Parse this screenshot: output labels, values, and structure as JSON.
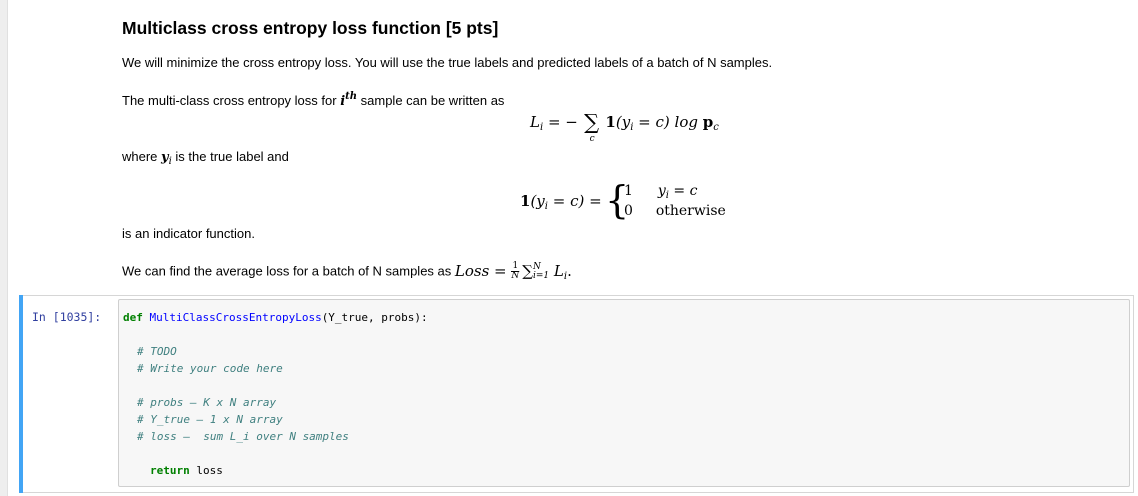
{
  "markdown": {
    "title": "Multiclass cross entropy loss function [5 pts]",
    "intro": "We will minimize the cross entropy loss. You will use the true labels and predicted labels of a batch of N samples.",
    "loss_intro_pre": "The multi-class cross entropy loss for ",
    "loss_intro_var": "i",
    "loss_intro_sup": "th",
    "loss_intro_post": " sample can be written as",
    "eq1": {
      "lhs": "L",
      "lhs_sub": "i",
      "equals": " = −",
      "sigma": "∑",
      "sigma_sub": "c",
      "indicator": "1",
      "arg_open": "(y",
      "arg_sub": "i",
      "arg_rest": " = c) log ",
      "p": "p",
      "p_sub": "c"
    },
    "where_pre": "where ",
    "where_var": "y",
    "where_sub": "i",
    "where_post": " is the true label and",
    "eq2": {
      "lhs_one": "1",
      "lhs_rest": "(y",
      "lhs_sub": "i",
      "lhs_end": " = c) =",
      "case1_val": "1",
      "case1_cond": "y",
      "case1_cond_sub": "i",
      "case1_cond_rest": " = c",
      "case2_val": "0",
      "case2_cond": "otherwise"
    },
    "indicator_text": "is an indicator function.",
    "avg_pre": "We can find the average loss for a batch of N samples as ",
    "avg_loss": "Loss",
    "avg_eq": " = ",
    "avg_frac_num": "1",
    "avg_frac_den": "N",
    "avg_sigma": "∑",
    "avg_sigma_sup": "N",
    "avg_sigma_sub": "i=1",
    "avg_L": "L",
    "avg_L_sub": "i",
    "avg_end": "."
  },
  "code_cell": {
    "prompt": "In  [1035]:",
    "def_kw": "def",
    "func_name": "MultiClassCrossEntropyLoss",
    "signature": "(Y_true, probs):",
    "comment_todo": "# TODO",
    "comment_write": "# Write your code here",
    "comment_probs": "# probs — K x N array",
    "comment_ytrue": "# Y_true — 1 x N array",
    "comment_loss": "# loss —  sum L_i over N samples",
    "return_kw": "return",
    "return_val": " loss"
  }
}
